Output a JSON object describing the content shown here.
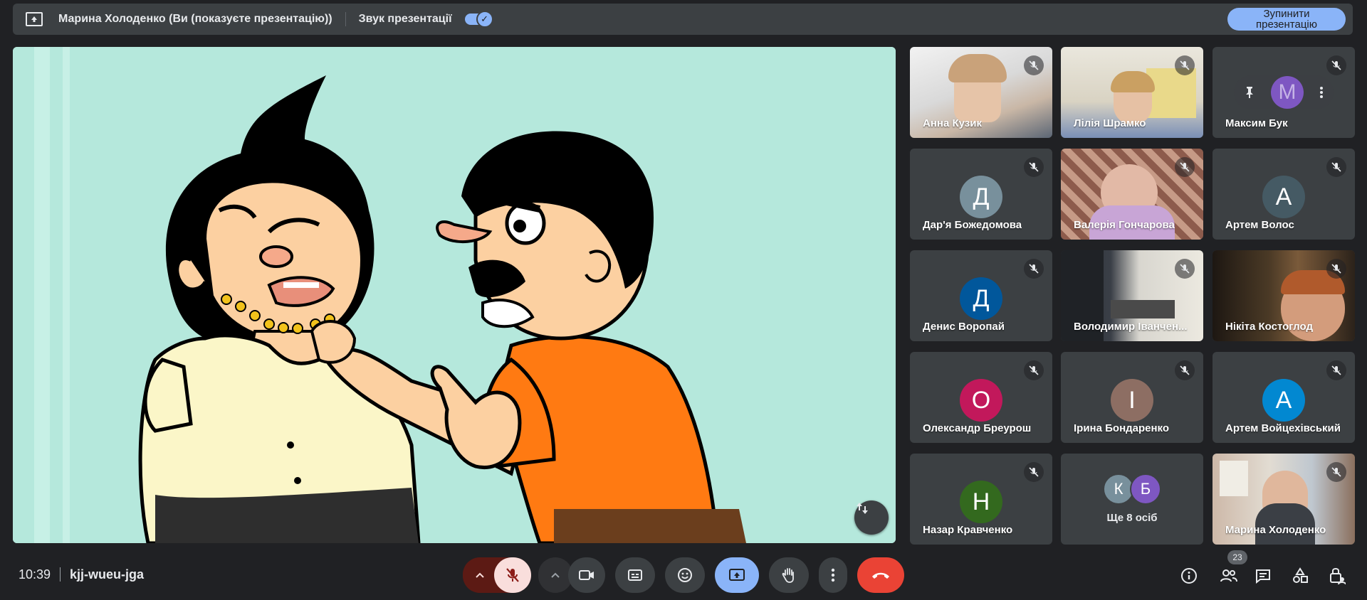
{
  "topbar": {
    "presenter_label": "Марина Холоденко (Ви (показуєте презентацію))",
    "sound_label": "Звук презентації",
    "sound_enabled": true,
    "stop_button": "Зупинити презентацію"
  },
  "stage": {
    "background": "#b5e8dc"
  },
  "participants": [
    {
      "name": "Анна Кузик",
      "type": "video",
      "muted": true
    },
    {
      "name": "Лілія Шрамко",
      "type": "video",
      "muted": true
    },
    {
      "name": "Максим Бук",
      "type": "avatar",
      "initial": "M",
      "color": "#7e57c2",
      "muted": true,
      "hovered": true
    },
    {
      "name": "Дар'я Божедомова",
      "type": "avatar",
      "initial": "Д",
      "color": "#78909c",
      "muted": true
    },
    {
      "name": "Валерія Гончарова",
      "type": "video",
      "muted": true
    },
    {
      "name": "Артем Волос",
      "type": "avatar",
      "initial": "А",
      "color": "#455a64",
      "muted": true
    },
    {
      "name": "Денис Воропай",
      "type": "avatar",
      "initial": "Д",
      "color": "#01579b",
      "muted": true
    },
    {
      "name": "Володимир Іванчен...",
      "type": "video",
      "muted": true
    },
    {
      "name": "Нікіта Костоглод",
      "type": "video",
      "muted": true
    },
    {
      "name": "Олександр Бреурош",
      "type": "avatar",
      "initial": "О",
      "color": "#c2185b",
      "muted": true
    },
    {
      "name": "Ірина Бондаренко",
      "type": "avatar",
      "initial": "І",
      "color": "#8d6e63",
      "muted": true
    },
    {
      "name": "Артем Войцехівський",
      "type": "avatar",
      "initial": "А",
      "color": "#0288d1",
      "muted": true
    },
    {
      "name": "Назар Кравченко",
      "type": "avatar",
      "initial": "Н",
      "color": "#33691e",
      "muted": true
    }
  ],
  "more": {
    "label": "Ще 8 осіб",
    "initials": [
      "К",
      "Б"
    ],
    "colors": [
      "#78909c",
      "#7e57c2"
    ]
  },
  "self_tile": {
    "name": "Марина Холоденко",
    "muted": true
  },
  "bottombar": {
    "time": "10:39",
    "meeting_code": "kjj-wueu-jga",
    "people_count": "23"
  },
  "colors": {
    "accent": "#8ab4f8",
    "danger": "#ea4335",
    "mic_off_bg": "#f9dedc"
  }
}
